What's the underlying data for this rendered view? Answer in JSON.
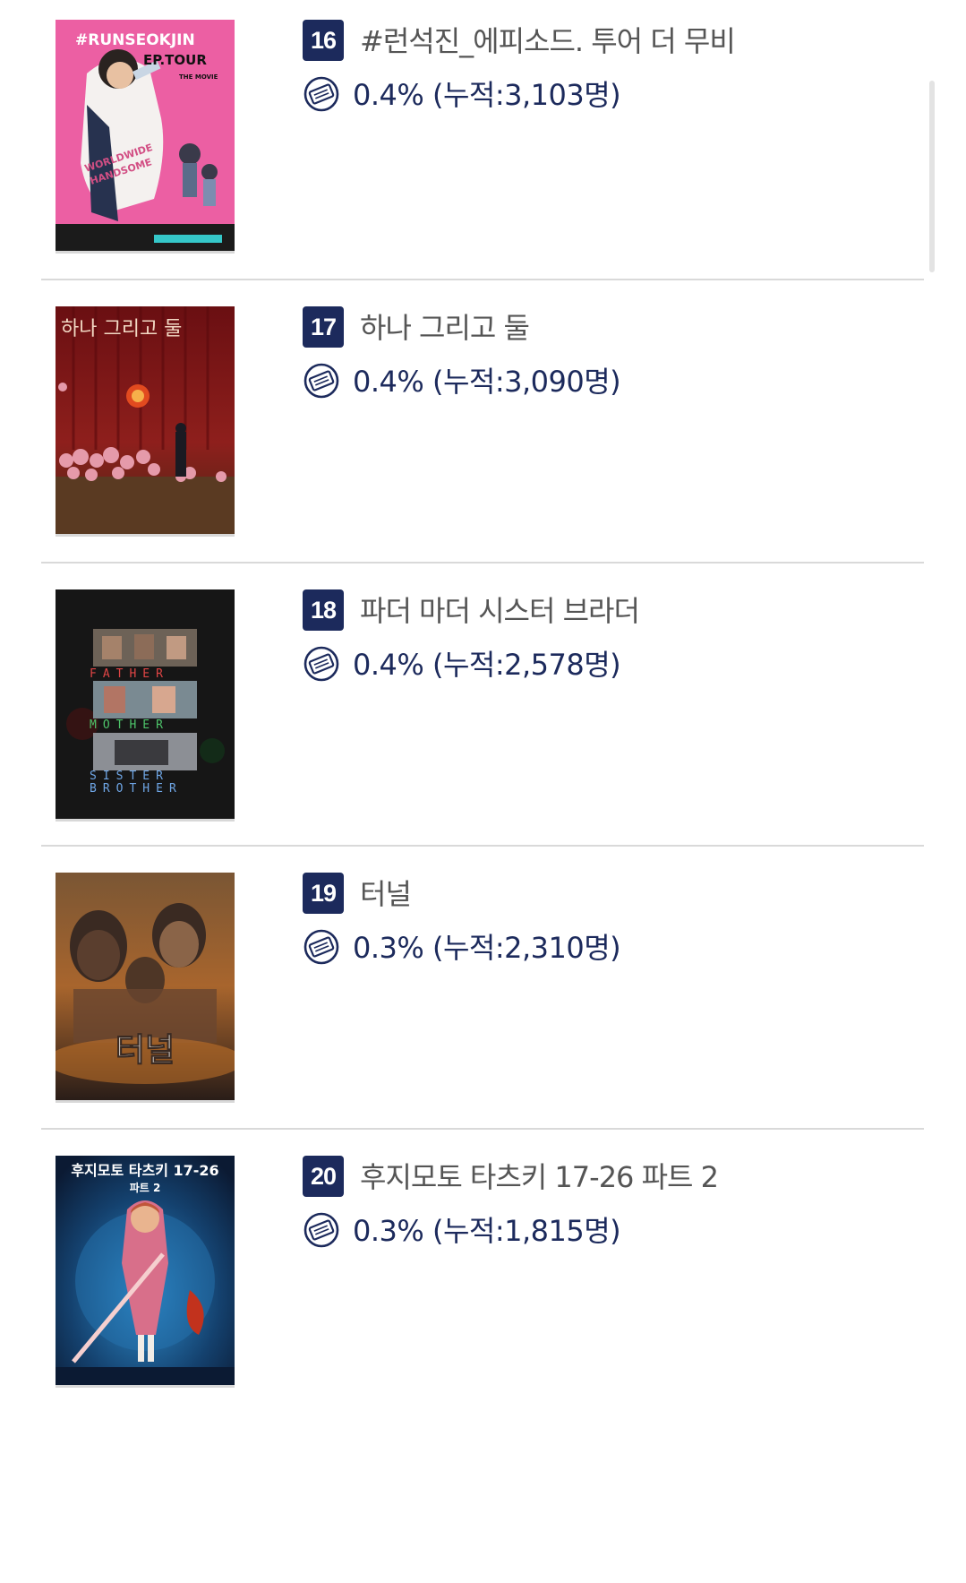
{
  "movies": [
    {
      "rank": "16",
      "title": "#런석진_에피소드. 투어 더 무비",
      "share": "0.4% (누적:3,103명)",
      "poster_alt": "#RUNSEOKJIN EP.TOUR THE MOVIE poster",
      "poster_texts": [
        "#RUNSEOKJIN",
        "EP.TOUR",
        "THE MOVIE",
        "WORLDWIDE",
        "HANDSOME"
      ]
    },
    {
      "rank": "17",
      "title": "하나 그리고 둘",
      "share": "0.4% (누적:3,090명)",
      "poster_alt": "하나 그리고 둘 poster",
      "poster_texts": [
        "하나 그리고 둘"
      ]
    },
    {
      "rank": "18",
      "title": "파더 마더 시스터 브라더",
      "share": "0.4% (누적:2,578명)",
      "poster_alt": "Father Mother Sister Brother poster",
      "poster_texts": [
        "FATHER",
        "MOTHER",
        "SISTER",
        "BROTHER"
      ]
    },
    {
      "rank": "19",
      "title": "터널",
      "share": "0.3% (누적:2,310명)",
      "poster_alt": "터널 poster",
      "poster_texts": [
        "터널"
      ]
    },
    {
      "rank": "20",
      "title": "후지모토 타츠키 17-26 파트 2",
      "share": "0.3% (누적:1,815명)",
      "poster_alt": "후지모토 타츠키 17-26 파트 2 poster",
      "poster_texts": [
        "후지모토 타츠키 17-26",
        "파트 2"
      ]
    }
  ],
  "icons": {
    "share": "ticket-icon"
  },
  "colors": {
    "rank_badge": "#1c2a5c",
    "share_text": "#1c2a5c",
    "title_text": "#555555",
    "divider": "#d9d9d9"
  }
}
